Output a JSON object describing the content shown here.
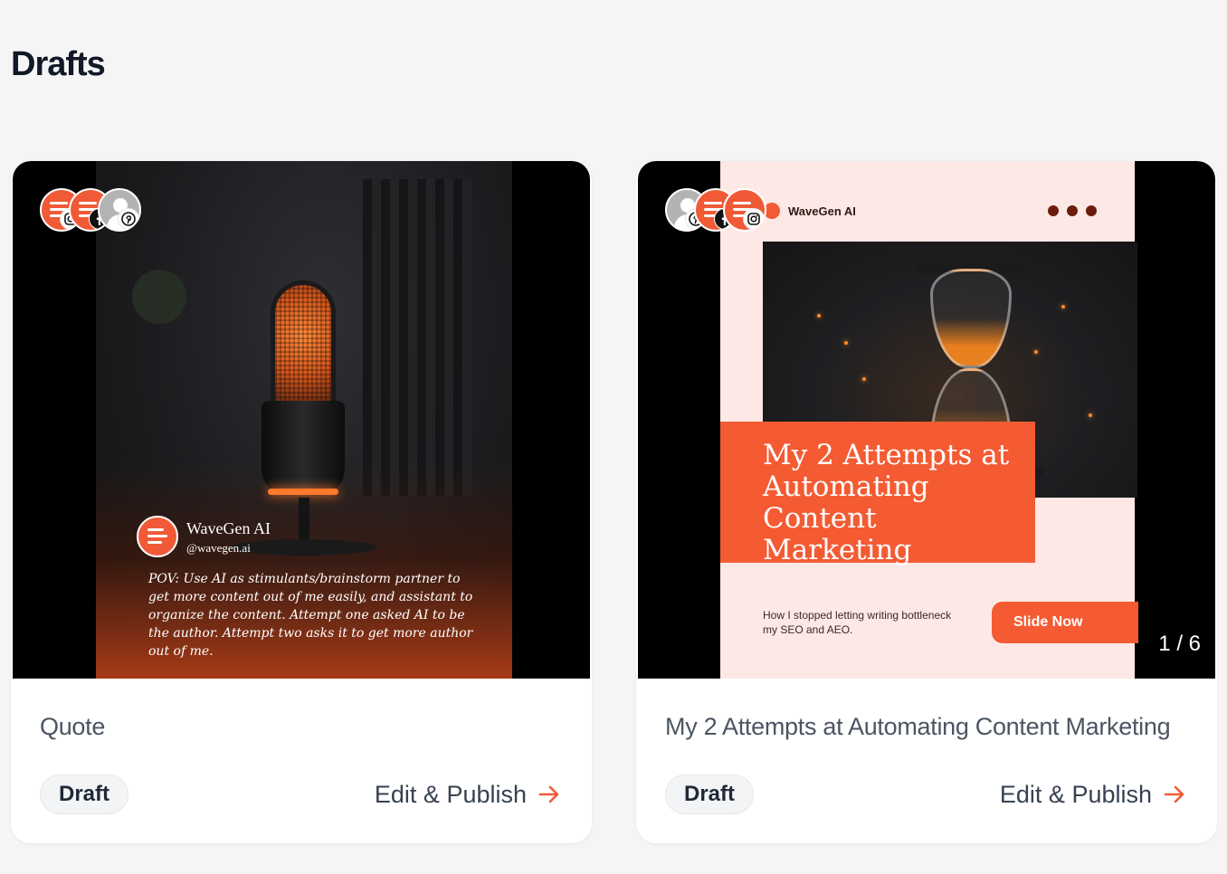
{
  "page": {
    "title": "Drafts"
  },
  "colors": {
    "accent": "#f05a36",
    "title_box": "#f45b33",
    "card_bg": "#ffffff",
    "page_bg": "#f5f5f6"
  },
  "cards": [
    {
      "title": "Quote",
      "status": "Draft",
      "action": "Edit & Publish",
      "platforms": [
        "instagram-icon",
        "facebook-icon",
        "pinterest-icon"
      ],
      "preview": {
        "brand": "WaveGen AI",
        "handle": "@wavegen.ai",
        "quote": "POV: Use AI as stimulants/brainstorm partner to get more content out of me easily, and assistant to organize the content. Attempt one asked AI to be the author. Attempt two asks it to get more author out of me."
      }
    },
    {
      "title": "My 2 Attempts at Automating Content Marketing",
      "status": "Draft",
      "action": "Edit & Publish",
      "platforms": [
        "pinterest-icon",
        "facebook-icon",
        "instagram-icon"
      ],
      "preview": {
        "brand": "WaveGen AI",
        "headline": "My 2 Attempts at Automating Content Marketing",
        "subtext": "How I stopped letting writing bottleneck my SEO and AEO.",
        "cta": "Slide Now",
        "page_counter": "1 / 6"
      }
    }
  ]
}
